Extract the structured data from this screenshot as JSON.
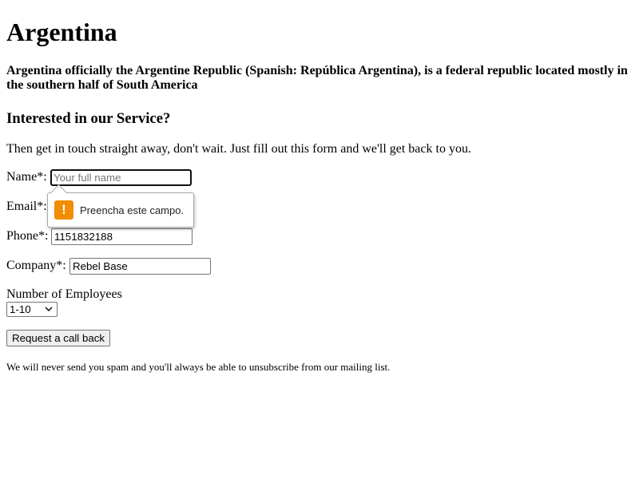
{
  "page": {
    "title": "Argentina",
    "lead": "Argentina officially the Argentine Republic (Spanish: República Argentina), is a federal republic located mostly in the southern half of South America",
    "section_heading": "Interested in our Service?",
    "intro": "Then get in touch straight away, don't wait. Just fill out this form and we'll get back to you."
  },
  "form": {
    "name": {
      "label": "Name*:",
      "value": "",
      "placeholder": "Your full name"
    },
    "email": {
      "label": "Email*:",
      "value": "",
      "placeholder": ""
    },
    "phone": {
      "label": "Phone*:",
      "value": "1151832188",
      "placeholder": ""
    },
    "company": {
      "label": "Company*:",
      "value": "Rebel Base",
      "placeholder": ""
    },
    "employees": {
      "label": "Number of Employees",
      "selected": "1-10"
    },
    "submit_label": "Request a call back",
    "disclaimer": "We will never send you spam and you'll always be able to unsubscribe from our mailing list."
  },
  "validation_tooltip": {
    "icon": "warning-icon",
    "icon_glyph": "!",
    "message": "Preencha este campo.",
    "icon_color": "#f28c00"
  }
}
